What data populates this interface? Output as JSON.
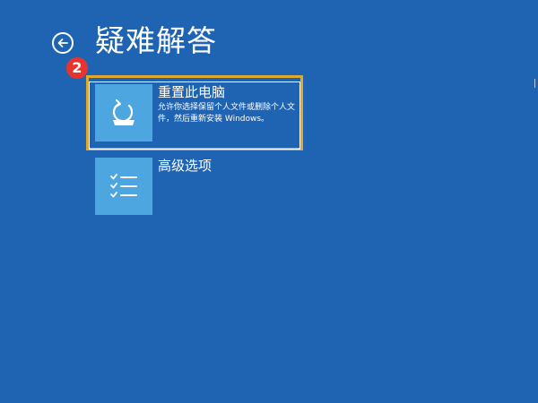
{
  "header": {
    "title": "疑难解答",
    "back_icon": "back-arrow-icon"
  },
  "badge": {
    "number": "2",
    "color": "#e8342e"
  },
  "options": [
    {
      "title": "重置此电脑",
      "description": "允许你选择保留个人文件或删除个人文件，然后重新安装 Windows。",
      "icon": "reset-pc-icon",
      "highlight_color": "#e0a82e"
    },
    {
      "title": "高级选项",
      "description": "",
      "icon": "checklist-icon"
    }
  ],
  "colors": {
    "background": "#1e64b3",
    "tile": "#4ea6e0"
  }
}
